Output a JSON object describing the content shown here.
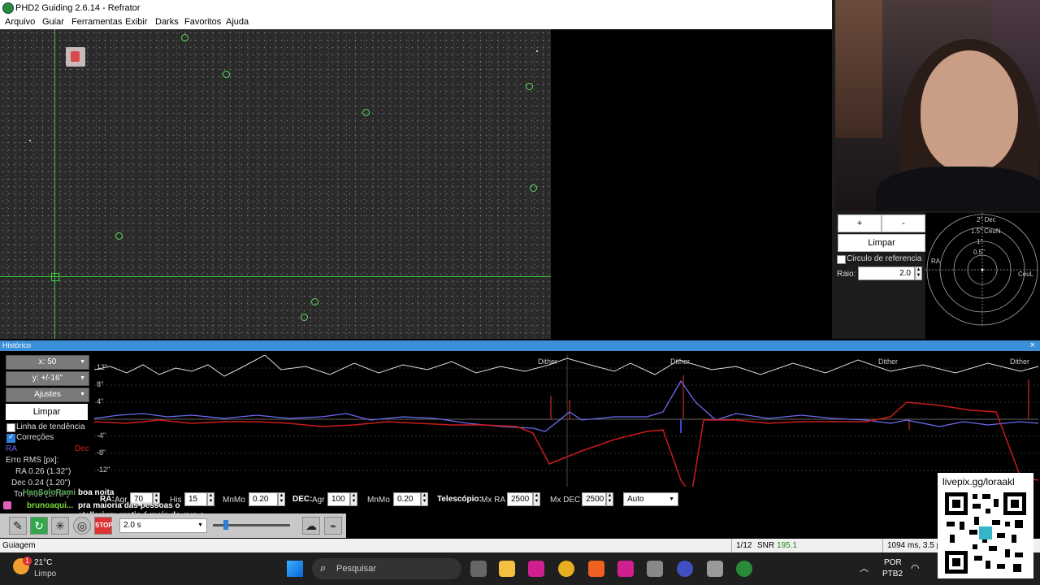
{
  "window": {
    "title": "PHD2 Guiding 2.6.14 - Refrator"
  },
  "menu": [
    "Arquivo",
    "Guiar",
    "Ferramentas",
    "Exibir",
    "Darks",
    "Favoritos",
    "Ajuda"
  ],
  "target_panel": {
    "plus": "+",
    "minus": "-",
    "clear": "Limpar",
    "ref_circle": "Circulo de referencia",
    "radius_label": "Raio:",
    "radius_value": "2.0",
    "labels": {
      "dec": "2\" Dec",
      "r15": "1.5\" CéuN",
      "r1": "1\"",
      "r05": "0.5\"",
      "ra": "RA",
      "ceul": "CéuL"
    }
  },
  "history": {
    "title": "Histórico",
    "close": "×",
    "x_combo": "x:  50",
    "y_combo": "y: +/-16\"",
    "settings_combo": "Ajustes",
    "clear": "Limpar",
    "trend": "Linha de tendência",
    "corrections": "Correções",
    "ra": "RA",
    "dec": "Dec",
    "rms_title": "Erro RMS [px]:",
    "rms_ra": "RA 0.26 (1.32'')",
    "rms_dec": "Dec 0.24 (1.20'')",
    "rms_tot": "Tot 0.36 (1.78'')",
    "y_ticks": [
      "12\"",
      "8\"",
      "4\"",
      "-4\"",
      "-8\"",
      "-12\""
    ],
    "dither_labels": [
      "Dither",
      "Dither",
      "Dither",
      "Dither"
    ]
  },
  "params": {
    "ra_label": "RA:",
    "agr": "Agr",
    "ra_agr": "70",
    "his": "His",
    "ra_his": "15",
    "mnmo": "MnMo",
    "ra_mnmo": "0.20",
    "dec_label": "DEC:",
    "dec_agr": "100",
    "dec_mnmo": "0.20",
    "tel_label": "Telescópio:",
    "mxra": "Mx RA",
    "mxra_val": "2500",
    "mxdec": "Mx DEC",
    "mxdec_val": "2500",
    "mode": "Auto"
  },
  "toolbar": {
    "exposure": "2.0 s",
    "stop": "STOP"
  },
  "status": {
    "left": "Guiagem",
    "frame": "1/12",
    "snr_label": "SNR",
    "snr_value": "195.1",
    "timing": "1094 ms, 3.5 p"
  },
  "chat": [
    {
      "user": "HanSoloRami",
      "msg": "boa noita"
    },
    {
      "user": "brunoaqui...",
      "msg": "pra maioria das pessoas o stellarium gratis é mais do que o suficiente"
    }
  ],
  "qr": {
    "url": "livepix.gg/loraakl"
  },
  "taskbar": {
    "temp": "21°C",
    "weather": "Limpo",
    "badge": "1",
    "search": "Pesquisar",
    "lang1": "POR",
    "lang2": "PTB2"
  }
}
